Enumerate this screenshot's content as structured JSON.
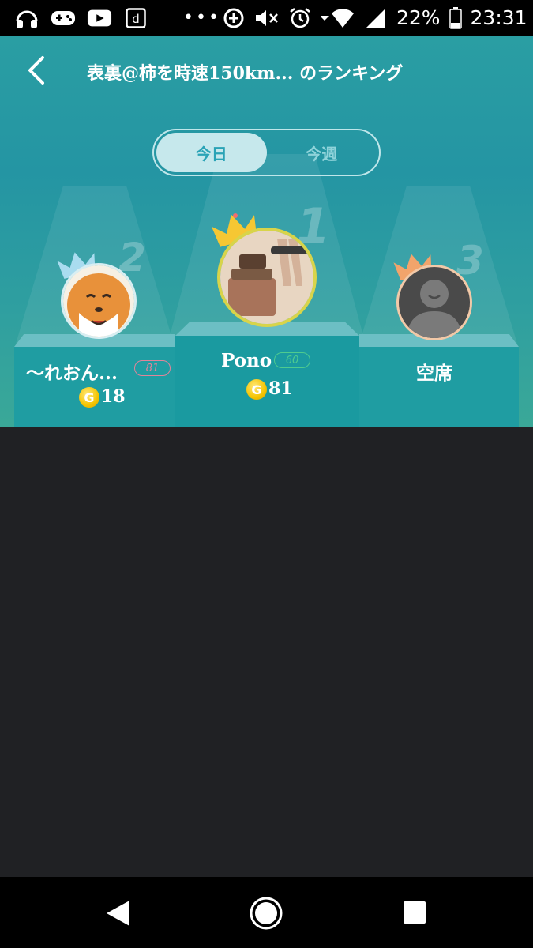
{
  "status_bar": {
    "battery": "22%",
    "time": "23:31",
    "left_icons": [
      "headphones-icon",
      "game-controller-icon",
      "youtube-icon",
      "d-app-icon"
    ],
    "right_icons": [
      "data-saver-icon",
      "mute-icon",
      "alarm-icon",
      "wifi-icon",
      "signal-icon",
      "battery-icon"
    ]
  },
  "header": {
    "title": "表裏@柿を時速150km... のランキング"
  },
  "tabs": [
    {
      "label": "今日",
      "active": true
    },
    {
      "label": "今週",
      "active": false
    }
  ],
  "podium": {
    "first": {
      "rank": "1",
      "name": "Pono",
      "level": "60",
      "coins": "81",
      "level_color": "#4ecb8f",
      "crown_color": "#f6c733"
    },
    "second": {
      "rank": "2",
      "name": "〜れおん...",
      "level": "81",
      "coins": "18",
      "level_color": "#e0859a",
      "crown_color": "#a9dcef"
    },
    "third": {
      "rank": "3",
      "name": "空席",
      "crown_color": "#f2a46b"
    }
  },
  "nav_bar": {
    "icons": [
      "back-triangle-icon",
      "home-circle-icon",
      "recents-square-icon"
    ]
  }
}
